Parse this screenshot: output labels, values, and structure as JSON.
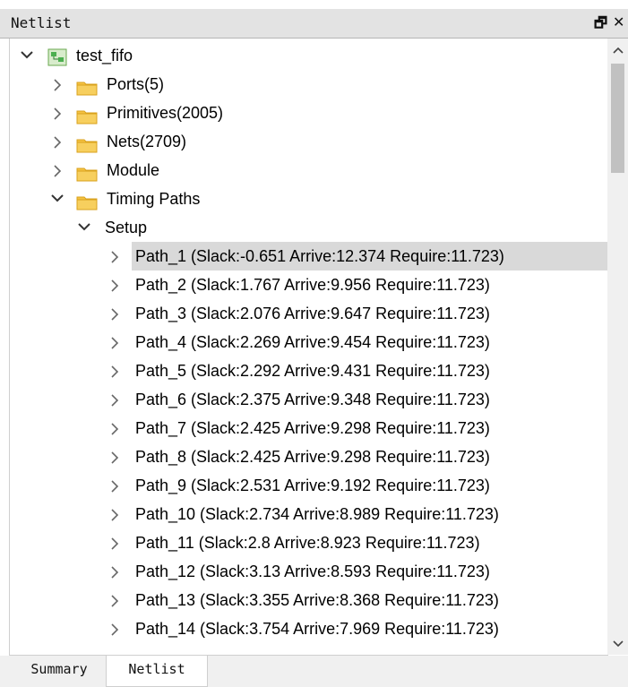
{
  "window": {
    "title": "Netlist",
    "float_icon": "restore-icon",
    "close_icon": "close-icon",
    "float_glyph": "🗗",
    "close_glyph": "✕"
  },
  "tree": {
    "root": {
      "label": "test_fifo",
      "icon": "module-icon",
      "expanded": true
    },
    "folders": [
      {
        "label": "Ports(5)",
        "expanded": false
      },
      {
        "label": "Primitives(2005)",
        "expanded": false
      },
      {
        "label": "Nets(2709)",
        "expanded": false
      },
      {
        "label": "Module",
        "expanded": false
      },
      {
        "label": "Timing Paths",
        "expanded": true
      }
    ],
    "setup": {
      "label": "Setup",
      "expanded": true
    },
    "paths": [
      "Path_1 (Slack:-0.651 Arrive:12.374 Require:11.723)",
      "Path_2 (Slack:1.767 Arrive:9.956 Require:11.723)",
      "Path_3 (Slack:2.076 Arrive:9.647 Require:11.723)",
      "Path_4 (Slack:2.269 Arrive:9.454 Require:11.723)",
      "Path_5 (Slack:2.292 Arrive:9.431 Require:11.723)",
      "Path_6 (Slack:2.375 Arrive:9.348 Require:11.723)",
      "Path_7 (Slack:2.425 Arrive:9.298 Require:11.723)",
      "Path_8 (Slack:2.425 Arrive:9.298 Require:11.723)",
      "Path_9 (Slack:2.531 Arrive:9.192 Require:11.723)",
      "Path_10 (Slack:2.734 Arrive:8.989 Require:11.723)",
      "Path_11 (Slack:2.8 Arrive:8.923 Require:11.723)",
      "Path_12 (Slack:3.13 Arrive:8.593 Require:11.723)",
      "Path_13 (Slack:3.355 Arrive:8.368 Require:11.723)",
      "Path_14 (Slack:3.754 Arrive:7.969 Require:11.723)"
    ],
    "selected_path": "Path_1 (Slack:-0.651 Arrive:12.374 Require:11.723)"
  },
  "tabs": {
    "summary": "Summary",
    "netlist": "Netlist",
    "active": "Netlist"
  },
  "colors": {
    "folder": "#f5c242",
    "folder_dark": "#d9a21c",
    "module_green": "#4caf50",
    "selection": "#d9d9d9"
  }
}
